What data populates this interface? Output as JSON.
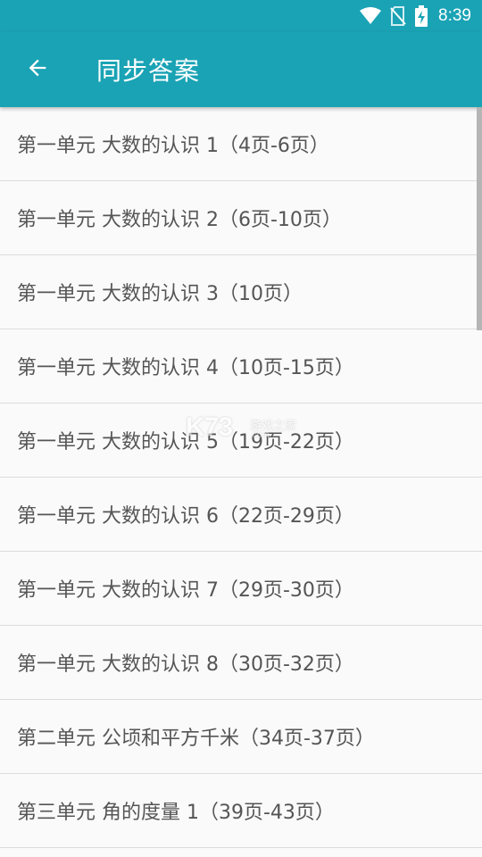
{
  "status_bar": {
    "time": "8:39",
    "icons": [
      "wifi-icon",
      "no-sim-icon",
      "battery-charging-icon"
    ]
  },
  "app_bar": {
    "back_icon": "arrow-left-icon",
    "title": "同步答案"
  },
  "colors": {
    "primary": "#1aa3b5",
    "text": "#555555",
    "divider": "#dcdcdc",
    "background": "#fafafa"
  },
  "list": {
    "items": [
      "第一单元 大数的认识 1（4页-6页）",
      "第一单元 大数的认识 2（6页-10页）",
      "第一单元 大数的认识 3（10页）",
      "第一单元 大数的认识 4（10页-15页）",
      "第一单元 大数的认识 5（19页-22页）",
      "第一单元 大数的认识 6（22页-29页）",
      "第一单元 大数的认识 7（29页-30页）",
      "第一单元 大数的认识 8（30页-32页）",
      "第二单元 公顷和平方千米（34页-37页）",
      "第三单元 角的度量 1（39页-43页）"
    ]
  },
  "watermark": {
    "logo": "K73",
    "text": "游戏之家",
    "url": ".com"
  }
}
